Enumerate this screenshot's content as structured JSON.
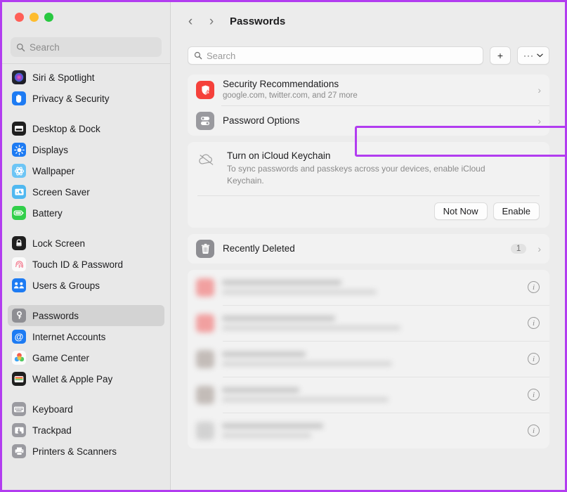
{
  "window": {
    "traffic_lights": [
      {
        "name": "close",
        "color": "#ff5f57"
      },
      {
        "name": "minimize",
        "color": "#febc2e"
      },
      {
        "name": "maximize",
        "color": "#28c840"
      }
    ]
  },
  "accent": {
    "highlight_border": "#b23cf0",
    "security_red": "#f5413b",
    "options_gray": "#9a9a9f"
  },
  "sidebar": {
    "search": {
      "placeholder": "Search",
      "value": "",
      "icon": "search-icon"
    },
    "groups": [
      {
        "items": [
          {
            "label": "Siri & Spotlight",
            "icon": "siri-icon",
            "selected": false
          },
          {
            "label": "Privacy & Security",
            "icon": "privacy-hand-icon",
            "selected": false
          }
        ]
      },
      {
        "items": [
          {
            "label": "Desktop & Dock",
            "icon": "desktop-dock-icon",
            "selected": false
          },
          {
            "label": "Displays",
            "icon": "displays-icon",
            "selected": false
          },
          {
            "label": "Wallpaper",
            "icon": "wallpaper-icon",
            "selected": false
          },
          {
            "label": "Screen Saver",
            "icon": "screen-saver-icon",
            "selected": false
          },
          {
            "label": "Battery",
            "icon": "battery-icon",
            "selected": false
          }
        ]
      },
      {
        "items": [
          {
            "label": "Lock Screen",
            "icon": "lock-screen-icon",
            "selected": false
          },
          {
            "label": "Touch ID & Password",
            "icon": "touch-id-icon",
            "selected": false
          },
          {
            "label": "Users & Groups",
            "icon": "users-groups-icon",
            "selected": false
          }
        ]
      },
      {
        "items": [
          {
            "label": "Passwords",
            "icon": "key-icon",
            "selected": true
          },
          {
            "label": "Internet Accounts",
            "icon": "at-sign-icon",
            "selected": false
          },
          {
            "label": "Game Center",
            "icon": "game-center-icon",
            "selected": false
          },
          {
            "label": "Wallet & Apple Pay",
            "icon": "wallet-icon",
            "selected": false
          }
        ]
      },
      {
        "items": [
          {
            "label": "Keyboard",
            "icon": "keyboard-icon",
            "selected": false
          },
          {
            "label": "Trackpad",
            "icon": "trackpad-icon",
            "selected": false
          },
          {
            "label": "Printers & Scanners",
            "icon": "printer-icon",
            "selected": false
          }
        ]
      }
    ]
  },
  "main": {
    "nav": {
      "back_icon": "chevron-left-icon",
      "forward_icon": "chevron-right-icon"
    },
    "title": "Passwords",
    "search": {
      "placeholder": "Search",
      "value": "",
      "icon": "search-icon"
    },
    "toolbar": {
      "add_label": "+",
      "more_label": "···",
      "more_chevron": "⌄"
    },
    "rows": [
      {
        "name": "security-recommendations",
        "title": "Security Recommendations",
        "subtitle": "google.com, twitter.com, and 27 more",
        "icon": "security-shield-warning-icon",
        "chevron": "›",
        "highlighted": false
      },
      {
        "name": "password-options",
        "title": "Password Options",
        "subtitle": "",
        "icon": "password-options-icon",
        "chevron": "›",
        "highlighted": true
      }
    ],
    "keychain": {
      "icon": "icloud-slash-icon",
      "title": "Turn on iCloud Keychain",
      "body": "To sync passwords and passkeys across your devices, enable iCloud Keychain.",
      "buttons": [
        {
          "name": "not-now-button",
          "label": "Not Now"
        },
        {
          "name": "enable-button",
          "label": "Enable"
        }
      ]
    },
    "recently_deleted": {
      "title": "Recently Deleted",
      "icon": "trash-icon",
      "count": "1",
      "chevron": "›"
    },
    "password_list": {
      "redacted": true,
      "items": [
        {
          "favicon_color": "#f1a0a0",
          "info_icon": "info-icon"
        },
        {
          "favicon_color": "#f1a0a0",
          "info_icon": "info-icon"
        },
        {
          "favicon_color": "#c3bcb8",
          "info_icon": "info-icon"
        },
        {
          "favicon_color": "#c3bcb8",
          "info_icon": "info-icon"
        },
        {
          "favicon_color": "#d2d2d2",
          "info_icon": "info-icon"
        }
      ]
    }
  }
}
